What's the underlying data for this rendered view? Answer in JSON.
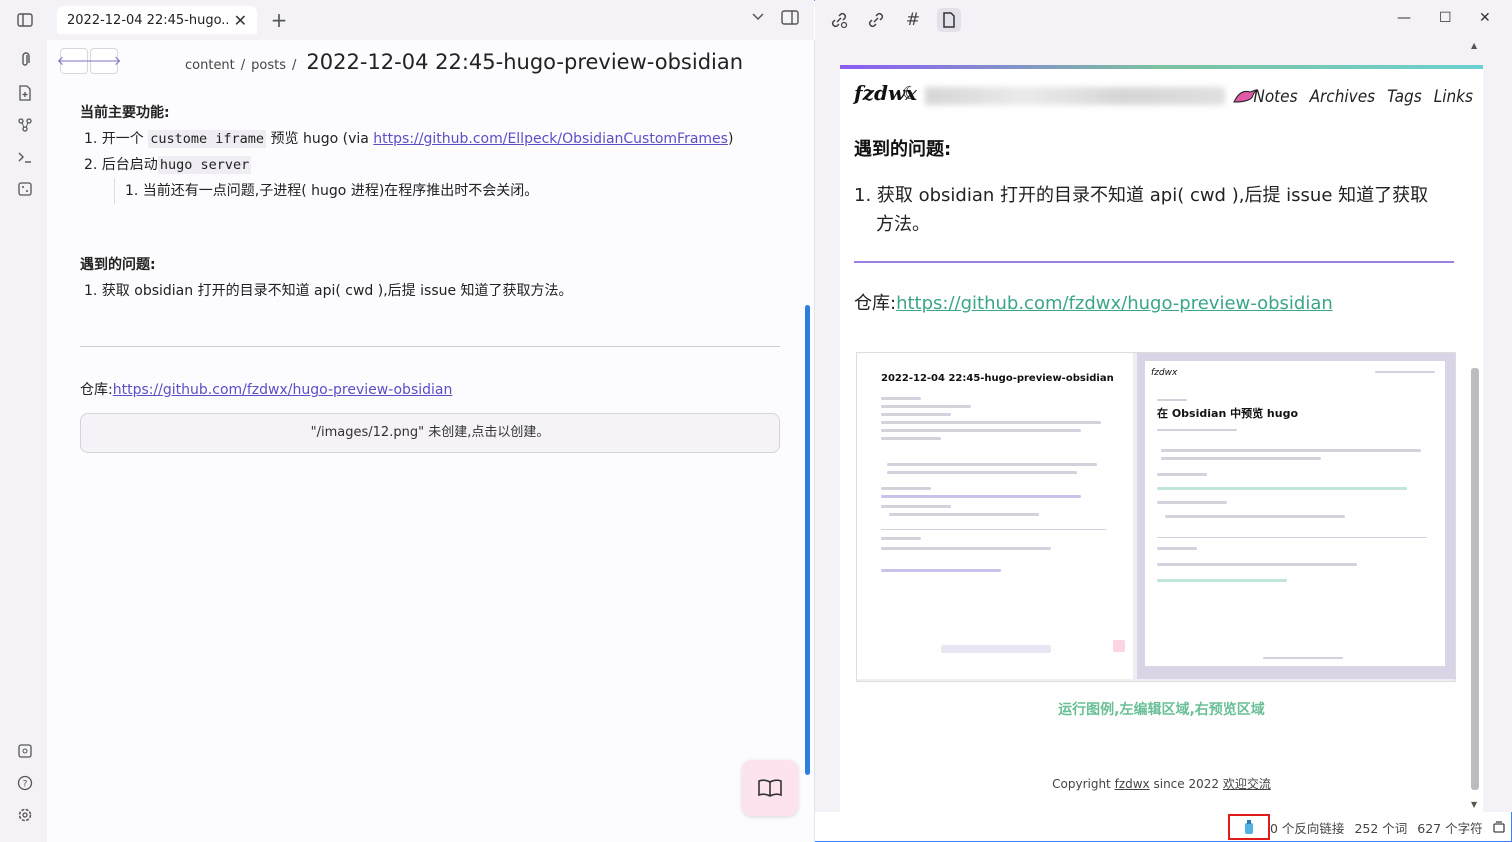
{
  "tab": {
    "title": "2022-12-04 22:45-hugo..."
  },
  "breadcrumb": {
    "folder1": "content",
    "folder2": "posts",
    "sep": "/",
    "title": "2022-12-04 22:45-hugo-preview-obsidian"
  },
  "editor": {
    "features_heading": "当前主要功能:",
    "item1_prefix": "1. 开一个",
    "item1_code": "custome iframe",
    "item1_mid": "预览 hugo (via",
    "item1_link": "https://github.com/Ellpeck/ObsidianCustomFrames",
    "item1_suffix": ")",
    "item2_prefix": "2. 后台启动",
    "item2_code": "hugo server",
    "item2_sub": "1. 当前还有一点问题,子进程( hugo 进程)在程序推出时不会关闭。",
    "issues_heading": "遇到的问题:",
    "issue1": "1. 获取 obsidian 打开的目录不知道 api( cwd ),后提 issue 知道了获取方法。",
    "repo_label": "仓库:",
    "repo_link": "https://github.com/fzdwx/hugo-preview-obsidian",
    "unresolved_embed": "\"/images/12.png\" 未创建,点击以创建。"
  },
  "preview": {
    "logo": "fzdwx",
    "nav": [
      "Notes",
      "Archives",
      "Tags",
      "Links"
    ],
    "issues_heading": "遇到的问题:",
    "issue1_line1": "1. 获取 obsidian 打开的目录不知道 api( cwd ),后提 issue 知道了获取",
    "issue1_line2": "方法。",
    "repo_label": "仓库:",
    "repo_link": "https://github.com/fzdwx/hugo-preview-obsidian",
    "caption": "运行图例,左编辑区域,右预览区域",
    "copyright_prefix": "Copyright",
    "copyright_author": "fzdwx",
    "copyright_since": "since 2022",
    "copyright_link": "欢迎交流",
    "shot_left_title": "2022-12-04 22:45-hugo-preview-obsidian",
    "shot_right_logo": "fzdwx",
    "shot_right_title": "在 Obsidian 中预览 hugo"
  },
  "status": {
    "backlinks": "0 个反向链接",
    "words": "252 个词",
    "chars": "627 个字符"
  },
  "icons": {
    "ribbon": [
      "sidebar-toggle-icon",
      "paperclip-icon",
      "file-plus-icon",
      "graph-icon",
      "terminal-icon",
      "dice-icon",
      "vault-icon",
      "help-icon",
      "settings-icon"
    ],
    "right_toolbar": [
      "link-icon",
      "unlink-icon",
      "hash-icon",
      "file-icon"
    ]
  },
  "colors": {
    "accent": "#7a74c8",
    "link": "#5b4fc7",
    "preview_link": "#3aa58a",
    "caption": "#6abf97"
  }
}
